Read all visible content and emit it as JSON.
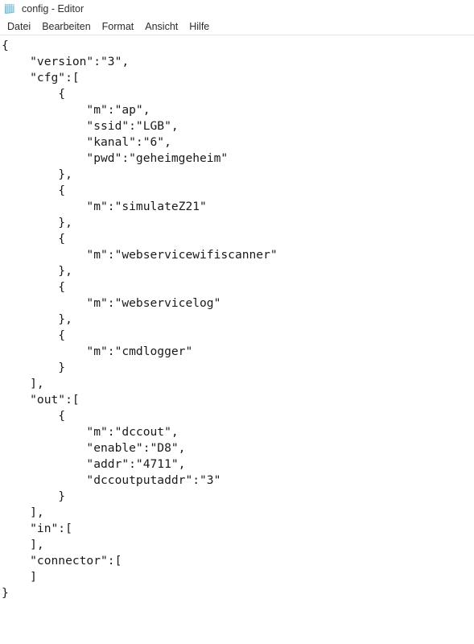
{
  "window": {
    "title": "config - Editor",
    "icon": "notepad-icon",
    "background_color": "#ffffff",
    "text_color": "#1a1a1a"
  },
  "menubar": {
    "items": [
      {
        "label": "Datei"
      },
      {
        "label": "Bearbeiten"
      },
      {
        "label": "Format"
      },
      {
        "label": "Ansicht"
      },
      {
        "label": "Hilfe"
      }
    ]
  },
  "editor": {
    "content": "{\n    \"version\":\"3\",\n    \"cfg\":[\n        {\n            \"m\":\"ap\",\n            \"ssid\":\"LGB\",\n            \"kanal\":\"6\",\n            \"pwd\":\"geheimgeheim\"\n        },\n        {\n            \"m\":\"simulateZ21\"\n        },\n        {\n            \"m\":\"webservicewifiscanner\"\n        },\n        {\n            \"m\":\"webservicelog\"\n        },\n        {\n            \"m\":\"cmdlogger\"\n        }\n    ],\n    \"out\":[\n        {\n            \"m\":\"dccout\",\n            \"enable\":\"D8\",\n            \"addr\":\"4711\",\n            \"dccoutputaddr\":\"3\"\n        }\n    ],\n    \"in\":[\n    ],\n    \"connector\":[\n    ]\n}"
  }
}
